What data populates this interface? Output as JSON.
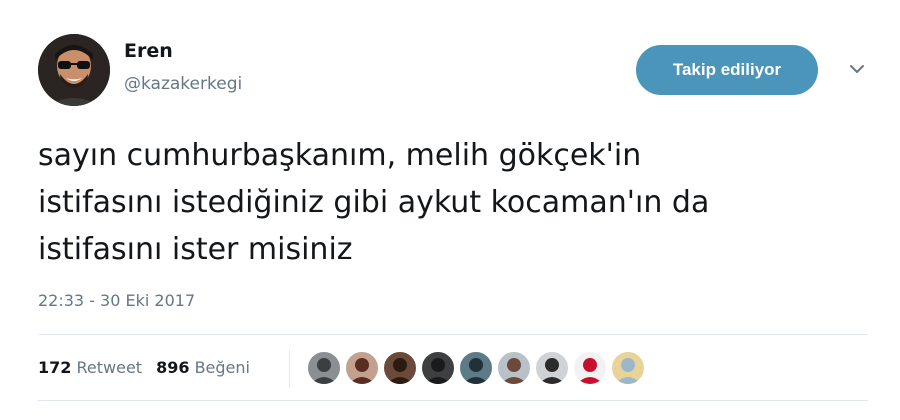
{
  "user": {
    "display_name": "Eren",
    "handle": "@kazakerkegi",
    "avatar_icon": "avatar-man-sunglasses"
  },
  "follow_button": {
    "label": "Takip ediliyor",
    "color": "#4b95ba"
  },
  "menu": {
    "icon": "chevron-down-icon"
  },
  "tweet": {
    "lines": [
      "sayın cumhurbaşkanım, melih gökçek'in",
      "istifasını istediğiniz gibi aykut kocaman'ın da",
      "istifasını ister misiniz"
    ],
    "timestamp": "22:33 - 30 Eki 2017"
  },
  "stats": {
    "retweets": {
      "count": "172",
      "label": "Retweet"
    },
    "likes": {
      "count": "896",
      "label": "Beğeni"
    }
  },
  "liker_avatars": [
    {
      "bg": "#8a8f93",
      "fg": "#3b3f42"
    },
    {
      "bg": "#c4a090",
      "fg": "#5a2d22"
    },
    {
      "bg": "#6b4a3a",
      "fg": "#2c1b14"
    },
    {
      "bg": "#3d3f41",
      "fg": "#1a1b1c"
    },
    {
      "bg": "#5c7a88",
      "fg": "#223038"
    },
    {
      "bg": "#b8c0c8",
      "fg": "#6b4a3a"
    },
    {
      "bg": "#d0d3d6",
      "fg": "#2b2b2b"
    },
    {
      "bg": "#f2f2f2",
      "fg": "#c8102e"
    },
    {
      "bg": "#e8d49a",
      "fg": "#9bb7c9"
    }
  ]
}
